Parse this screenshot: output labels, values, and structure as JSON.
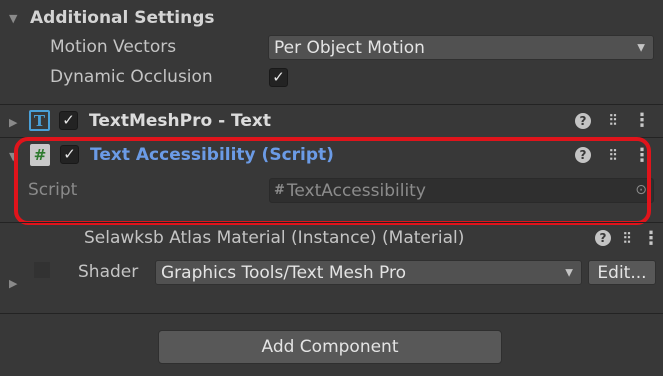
{
  "additional_settings": {
    "title": "Additional Settings",
    "motion_vectors_label": "Motion Vectors",
    "motion_vectors_value": "Per Object Motion",
    "dynamic_occlusion_label": "Dynamic Occlusion",
    "dynamic_occlusion_checked": true
  },
  "components": {
    "textmeshpro": {
      "title": "TextMeshPro - Text",
      "icon": "T",
      "enabled": true
    },
    "text_accessibility": {
      "title": "Text Accessibility (Script)",
      "icon": "#",
      "enabled": true,
      "script_label": "Script",
      "script_value": "TextAccessibility"
    },
    "material": {
      "title": "Selawksb Atlas Material (Instance) (Material)",
      "shader_label": "Shader",
      "shader_value": "Graphics Tools/Text Mesh Pro",
      "edit_label": "Edit..."
    }
  },
  "add_component_label": "Add Component",
  "colors": {
    "highlight": "#e0141b",
    "script_title": "#6b9be6"
  }
}
